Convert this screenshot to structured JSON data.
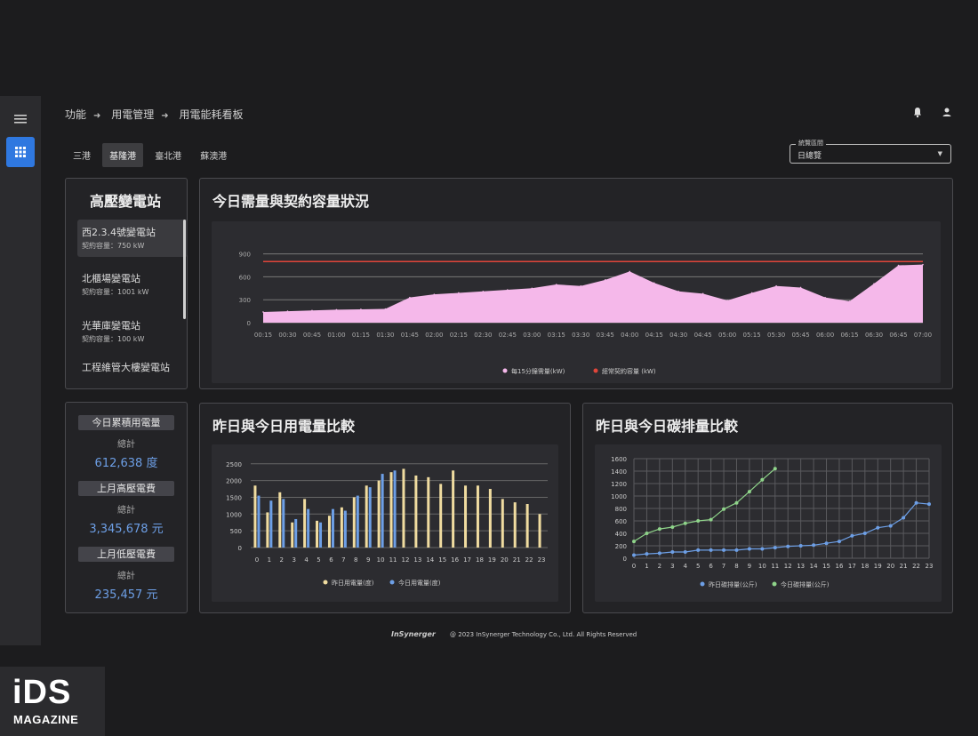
{
  "breadcrumb": [
    "功能",
    "用電管理",
    "用電能耗看板"
  ],
  "tabs": [
    {
      "label": "三港",
      "active": false
    },
    {
      "label": "基隆港",
      "active": true
    },
    {
      "label": "臺北港",
      "active": false
    },
    {
      "label": "蘇澳港",
      "active": false
    }
  ],
  "period_select": {
    "legend": "統覽區間",
    "value": "日總覽"
  },
  "substations": {
    "title": "高壓變電站",
    "items": [
      {
        "name": "西2.3.4號變電站",
        "capacity": "契約容量：750 kW",
        "selected": true
      },
      {
        "name": "北櫃場變電站",
        "capacity": "契約容量：1001 kW",
        "selected": false
      },
      {
        "name": "光華庫變電站",
        "capacity": "契約容量：100 kW",
        "selected": false
      },
      {
        "name": "工程維管大樓變電站",
        "capacity": "",
        "selected": false
      }
    ]
  },
  "kpis": [
    {
      "label": "今日累積用電量",
      "sub": "總計",
      "value": "612,638 度"
    },
    {
      "label": "上月高壓電費",
      "sub": "總計",
      "value": "3,345,678 元"
    },
    {
      "label": "上月低壓電費",
      "sub": "總計",
      "value": "235,457 元"
    }
  ],
  "panel_titles": {
    "demand": "今日需量與契約容量狀況",
    "usage": "昨日與今日用電量比較",
    "carbon": "昨日與今日碳排量比較"
  },
  "footer": {
    "logo": "InSynerger",
    "copyright": "@ 2023 InSynerger Technology Co., Ltd. All Rights Reserved"
  },
  "watermark": {
    "big": "iDS",
    "small": "MAGAZINE"
  },
  "colors": {
    "accent": "#2f78e0",
    "demand_fill": "#f5b8ea",
    "contract_line": "#e0453a",
    "yesterday": "#f0dca0",
    "today": "#6d9fe6",
    "carbon_yesterday": "#6d9fe6",
    "carbon_today": "#8fd48a"
  },
  "chart_data": [
    {
      "type": "area",
      "x": [
        "00:15",
        "00:30",
        "00:45",
        "01:00",
        "01:15",
        "01:30",
        "01:45",
        "02:00",
        "02:15",
        "02:30",
        "02:45",
        "03:00",
        "03:15",
        "03:30",
        "03:45",
        "04:00",
        "04:15",
        "04:30",
        "04:45",
        "05:00",
        "05:15",
        "05:30",
        "05:45",
        "06:00",
        "06:15",
        "06:30",
        "06:45",
        "07:00"
      ],
      "series": [
        {
          "name": "每15分鐘需量(kW)",
          "values": [
            140,
            150,
            160,
            170,
            175,
            180,
            330,
            370,
            390,
            410,
            430,
            450,
            500,
            480,
            560,
            670,
            520,
            410,
            380,
            290,
            390,
            480,
            460,
            330,
            280,
            510,
            750,
            760
          ]
        },
        {
          "name": "經常契約容量 (kW)",
          "values": [
            800,
            800,
            800,
            800,
            800,
            800,
            800,
            800,
            800,
            800,
            800,
            800,
            800,
            800,
            800,
            800,
            800,
            800,
            800,
            800,
            800,
            800,
            800,
            800,
            800,
            800,
            800,
            800
          ]
        }
      ],
      "yticks": [
        0,
        300,
        600,
        900
      ],
      "ylim": [
        0,
        1000
      ]
    },
    {
      "type": "bar",
      "categories": [
        "0",
        "1",
        "2",
        "3",
        "4",
        "5",
        "6",
        "7",
        "8",
        "9",
        "10",
        "11",
        "12",
        "13",
        "14",
        "15",
        "16",
        "17",
        "18",
        "19",
        "20",
        "21",
        "22",
        "23"
      ],
      "series": [
        {
          "name": "昨日用電量(度)",
          "values": [
            1850,
            1050,
            1650,
            750,
            1450,
            800,
            950,
            1200,
            1500,
            1850,
            2000,
            2250,
            2350,
            2150,
            2100,
            1900,
            2300,
            1850,
            1850,
            1750,
            1450,
            1350,
            1300,
            1000
          ]
        },
        {
          "name": "今日用電量(度)",
          "values": [
            1550,
            1400,
            1450,
            850,
            1150,
            750,
            1150,
            1100,
            1550,
            1800,
            2200,
            2300,
            null,
            null,
            null,
            null,
            null,
            null,
            null,
            null,
            null,
            null,
            null,
            null
          ]
        }
      ],
      "yticks": [
        0,
        500,
        1000,
        1500,
        2000,
        2500
      ],
      "ylim": [
        0,
        2600
      ]
    },
    {
      "type": "line",
      "x": [
        "0",
        "1",
        "2",
        "3",
        "4",
        "5",
        "6",
        "7",
        "8",
        "9",
        "10",
        "11",
        "12",
        "13",
        "14",
        "15",
        "16",
        "17",
        "18",
        "19",
        "20",
        "21",
        "22",
        "23"
      ],
      "series": [
        {
          "name": "昨日碳排量(公斤)",
          "values": [
            50,
            70,
            80,
            100,
            100,
            130,
            130,
            130,
            130,
            150,
            150,
            170,
            190,
            200,
            210,
            240,
            270,
            360,
            400,
            490,
            520,
            650,
            890,
            870
          ]
        },
        {
          "name": "今日碳排量(公斤)",
          "values": [
            270,
            400,
            470,
            500,
            560,
            600,
            620,
            790,
            890,
            1070,
            1260,
            1440,
            null,
            null,
            null,
            null,
            null,
            null,
            null,
            null,
            null,
            null,
            null,
            null
          ]
        }
      ],
      "yticks": [
        0,
        200,
        400,
        600,
        800,
        1000,
        1200,
        1400,
        1600
      ],
      "ylim": [
        0,
        1600
      ]
    }
  ]
}
